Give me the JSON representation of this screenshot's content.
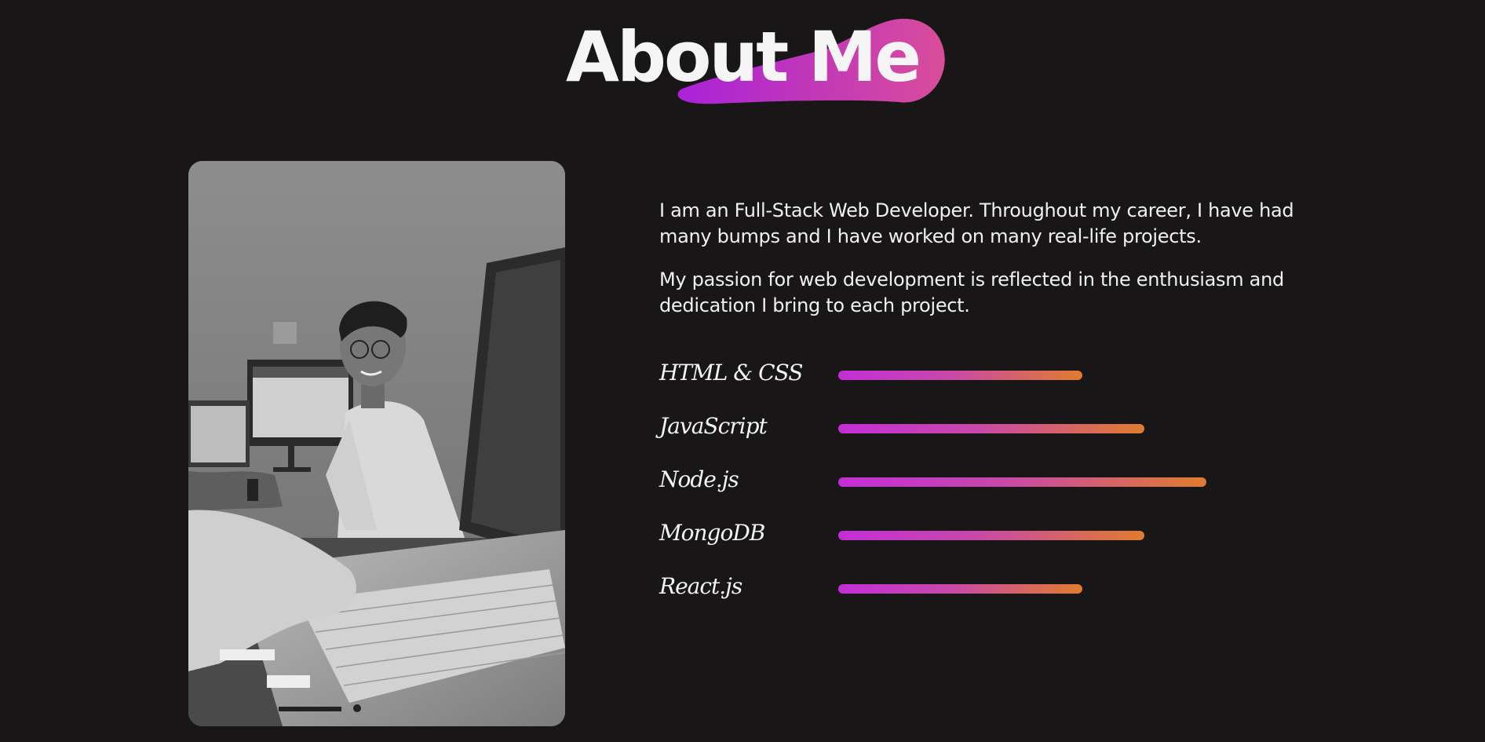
{
  "header": {
    "title": "About Me"
  },
  "colors": {
    "background": "#181616",
    "accent_start": "#c22fd6",
    "accent_end": "#e07c2e"
  },
  "photo": {
    "alt": "Portrait photo of developer at laptop (grayscale)"
  },
  "about": {
    "paragraphs": [
      "I am an Full-Stack Web Developer. Throughout my career, I have had many bumps and I have worked on many real-life projects.",
      "My passion for web development is reflected in the enthusiasm and dedication I bring to each project."
    ]
  },
  "skills": [
    {
      "name": "HTML & CSS",
      "level": 0.55
    },
    {
      "name": "JavaScript",
      "level": 0.69
    },
    {
      "name": "Node.js",
      "level": 0.83
    },
    {
      "name": "MongoDB",
      "level": 0.69
    },
    {
      "name": "React.js",
      "level": 0.55
    }
  ]
}
